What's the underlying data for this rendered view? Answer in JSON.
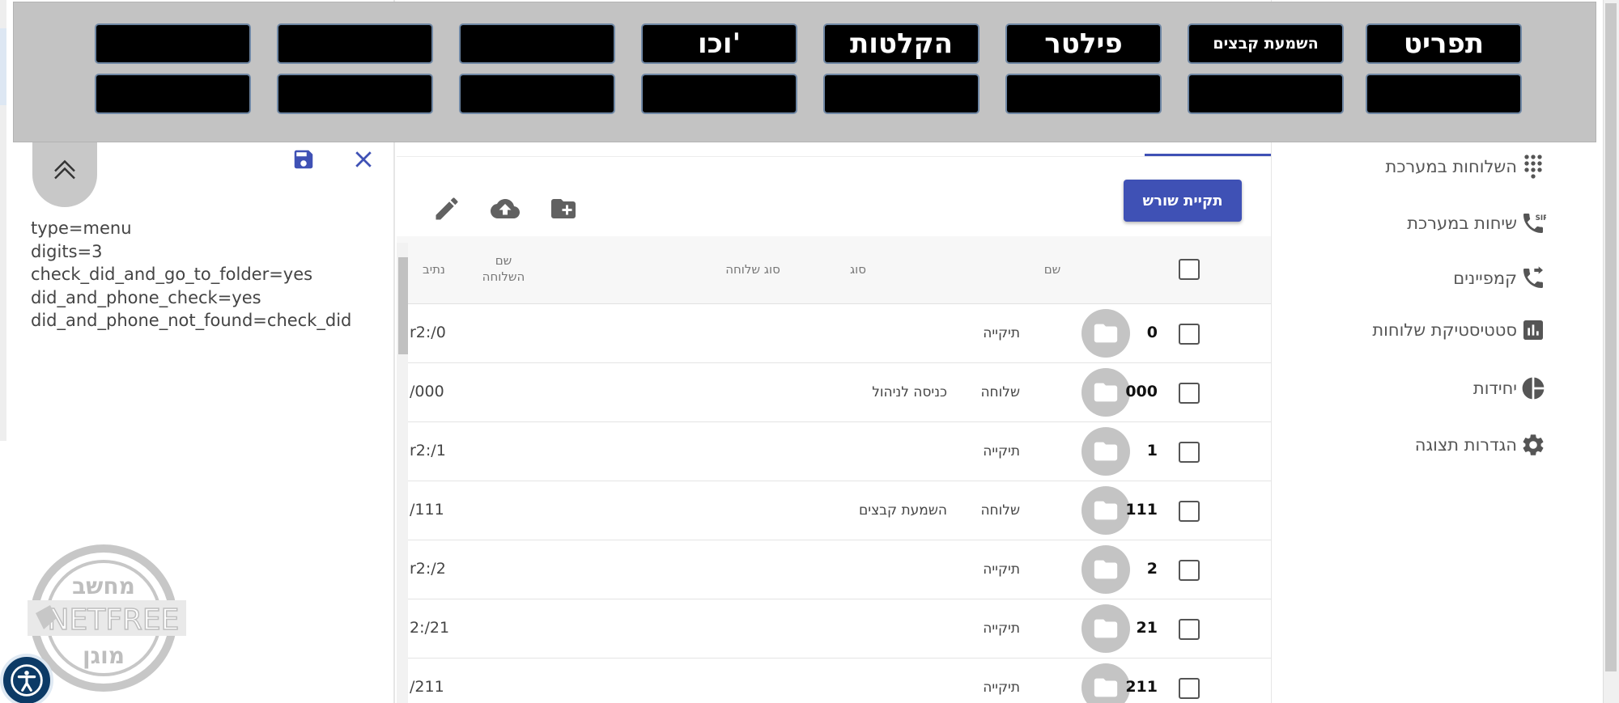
{
  "overlay": {
    "row1": [
      "תפריט",
      "השמעת קבצים",
      "פילטר",
      "הקלטות",
      "וכו'",
      "",
      "",
      ""
    ],
    "row2": [
      "",
      "",
      "",
      "",
      "",
      "",
      "",
      ""
    ]
  },
  "editor": {
    "code_lines": [
      "type=menu",
      "digits=3",
      "check_did_and_go_to_folder=yes",
      "did_and_phone_check=yes",
      "did_and_phone_not_found=check_did"
    ]
  },
  "watermark": {
    "top_text": "מחשב",
    "middle_text": "NETFREE",
    "bottom_text": "מוגן"
  },
  "toolbar": {
    "root_folder_label": "תקיית שורש"
  },
  "table": {
    "headers": {
      "name": "שם",
      "type": "סוג",
      "ext_type": "סוג שלוחה",
      "ext_name": "שם השלוחה",
      "path": "נתיב"
    },
    "rows": [
      {
        "name": "0",
        "type": "תיקייה",
        "ext_type": "",
        "path": "r2:/0"
      },
      {
        "name": "000",
        "type": "שלוחה",
        "ext_type": "כניסה לניהול",
        "path": "/000"
      },
      {
        "name": "1",
        "type": "תיקייה",
        "ext_type": "",
        "path": "r2:/1"
      },
      {
        "name": "111",
        "type": "שלוחה",
        "ext_type": "השמעת קבצים",
        "path": "/111"
      },
      {
        "name": "2",
        "type": "תיקייה",
        "ext_type": "",
        "path": "r2:/2"
      },
      {
        "name": "21",
        "type": "תיקייה",
        "ext_type": "",
        "path": "2:/21"
      },
      {
        "name": "211",
        "type": "תיקייה",
        "ext_type": "",
        "path": "/211"
      }
    ]
  },
  "sidebar": {
    "items": [
      {
        "label": "השלוחות במערכת",
        "icon": "dialpad-icon"
      },
      {
        "label": "שיחות במערכת",
        "icon": "sip-phone-icon"
      },
      {
        "label": "קמפיינים",
        "icon": "phone-forward-icon"
      },
      {
        "label": "סטטיסטיקת שלוחות",
        "icon": "bar-chart-icon"
      },
      {
        "label": "יחידות",
        "icon": "pie-chart-icon"
      },
      {
        "label": "הגדרות תצוגה",
        "icon": "gear-icon"
      }
    ]
  },
  "colors": {
    "primary": "#3f51b5",
    "overlay_bg": "#c3c3c3",
    "overlay_button": "#000000",
    "accessibility": "#0c3a66"
  }
}
